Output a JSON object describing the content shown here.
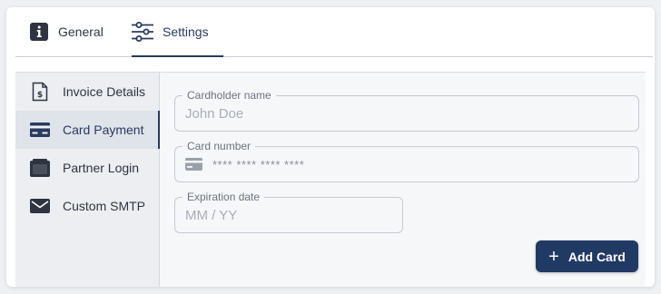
{
  "tabs": [
    {
      "label": "General",
      "icon": "info-icon",
      "active": false
    },
    {
      "label": "Settings",
      "icon": "sliders-icon",
      "active": true
    }
  ],
  "sidebar": {
    "items": [
      {
        "label": "Invoice Details",
        "icon": "invoice-icon",
        "active": false
      },
      {
        "label": "Card Payment",
        "icon": "credit-card-icon",
        "active": true
      },
      {
        "label": "Partner Login",
        "icon": "wallet-icon",
        "active": false
      },
      {
        "label": "Custom SMTP",
        "icon": "envelope-icon",
        "active": false
      }
    ]
  },
  "form": {
    "cardholder": {
      "label": "Cardholder name",
      "placeholder": "John Doe",
      "value": ""
    },
    "card_number": {
      "label": "Card number",
      "placeholder": "**** **** **** ****",
      "value": "",
      "icon": "credit-card-icon"
    },
    "expiration": {
      "label": "Expiration date",
      "placeholder": "MM / YY",
      "value": ""
    },
    "add_button": {
      "label": "Add Card",
      "icon": "plus-icon"
    }
  },
  "colors": {
    "accent": "#2a3a5c",
    "button": "#213a64",
    "sidebar_bg": "#eceef2",
    "content_bg": "#f6f7f9"
  }
}
